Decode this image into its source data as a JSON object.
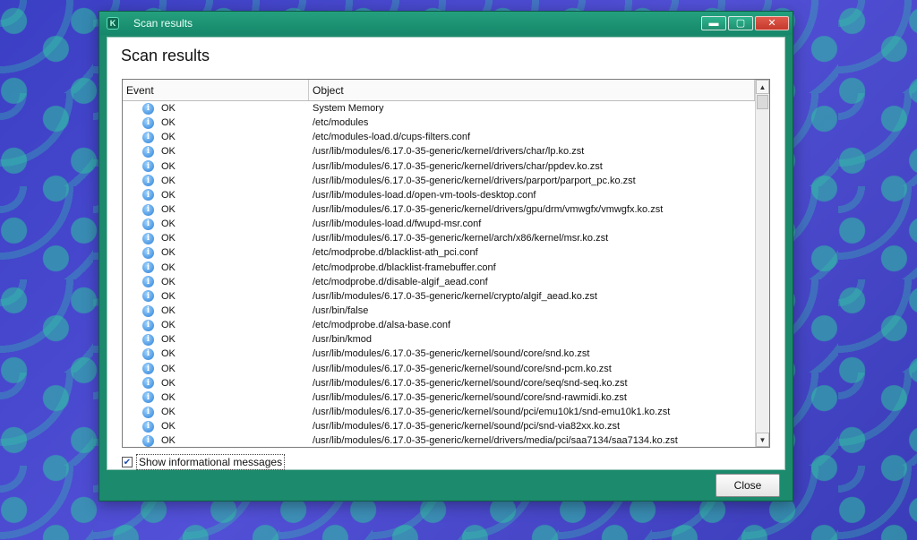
{
  "window": {
    "title": "Scan results",
    "app_icon_letter": "K",
    "buttons": {
      "minimize": "▬",
      "maximize": "▢",
      "close": "✕"
    }
  },
  "dialog": {
    "heading": "Scan results",
    "columns": {
      "event": "Event",
      "object": "Object"
    },
    "rows": [
      {
        "event": "OK",
        "object": "System Memory"
      },
      {
        "event": "OK",
        "object": "/etc/modules"
      },
      {
        "event": "OK",
        "object": "/etc/modules-load.d/cups-filters.conf"
      },
      {
        "event": "OK",
        "object": "/usr/lib/modules/6.17.0-35-generic/kernel/drivers/char/lp.ko.zst"
      },
      {
        "event": "OK",
        "object": "/usr/lib/modules/6.17.0-35-generic/kernel/drivers/char/ppdev.ko.zst"
      },
      {
        "event": "OK",
        "object": "/usr/lib/modules/6.17.0-35-generic/kernel/drivers/parport/parport_pc.ko.zst"
      },
      {
        "event": "OK",
        "object": "/usr/lib/modules-load.d/open-vm-tools-desktop.conf"
      },
      {
        "event": "OK",
        "object": "/usr/lib/modules/6.17.0-35-generic/kernel/drivers/gpu/drm/vmwgfx/vmwgfx.ko.zst"
      },
      {
        "event": "OK",
        "object": "/usr/lib/modules-load.d/fwupd-msr.conf"
      },
      {
        "event": "OK",
        "object": "/usr/lib/modules/6.17.0-35-generic/kernel/arch/x86/kernel/msr.ko.zst"
      },
      {
        "event": "OK",
        "object": "/etc/modprobe.d/blacklist-ath_pci.conf"
      },
      {
        "event": "OK",
        "object": "/etc/modprobe.d/blacklist-framebuffer.conf"
      },
      {
        "event": "OK",
        "object": "/etc/modprobe.d/disable-algif_aead.conf"
      },
      {
        "event": "OK",
        "object": "/usr/lib/modules/6.17.0-35-generic/kernel/crypto/algif_aead.ko.zst"
      },
      {
        "event": "OK",
        "object": "/usr/bin/false"
      },
      {
        "event": "OK",
        "object": "/etc/modprobe.d/alsa-base.conf"
      },
      {
        "event": "OK",
        "object": "/usr/bin/kmod"
      },
      {
        "event": "OK",
        "object": "/usr/lib/modules/6.17.0-35-generic/kernel/sound/core/snd.ko.zst"
      },
      {
        "event": "OK",
        "object": "/usr/lib/modules/6.17.0-35-generic/kernel/sound/core/snd-pcm.ko.zst"
      },
      {
        "event": "OK",
        "object": "/usr/lib/modules/6.17.0-35-generic/kernel/sound/core/seq/snd-seq.ko.zst"
      },
      {
        "event": "OK",
        "object": "/usr/lib/modules/6.17.0-35-generic/kernel/sound/core/snd-rawmidi.ko.zst"
      },
      {
        "event": "OK",
        "object": "/usr/lib/modules/6.17.0-35-generic/kernel/sound/pci/emu10k1/snd-emu10k1.ko.zst"
      },
      {
        "event": "OK",
        "object": "/usr/lib/modules/6.17.0-35-generic/kernel/sound/pci/snd-via82xx.ko.zst"
      },
      {
        "event": "OK",
        "object": "/usr/lib/modules/6.17.0-35-generic/kernel/drivers/media/pci/saa7134/saa7134.ko.zst"
      }
    ],
    "show_info_checkbox": {
      "label": "Show informational messages",
      "checked": true,
      "mark": "✔"
    },
    "close_button": "Close"
  },
  "icons": {
    "info": "i",
    "scroll_up": "▲",
    "scroll_down": "▼"
  },
  "colors": {
    "window_frame": "#1c8a6c",
    "accent": "#2a7fd6"
  }
}
